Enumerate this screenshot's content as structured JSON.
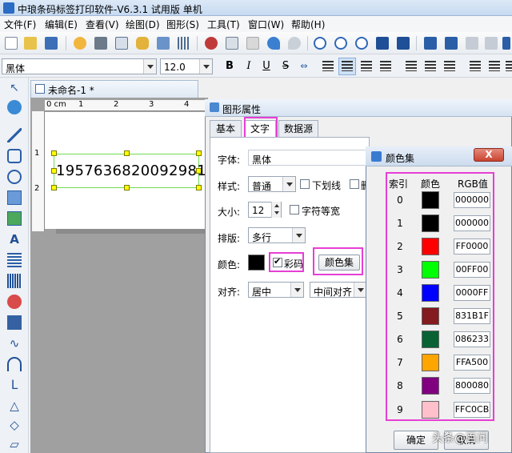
{
  "app": {
    "title": "中琅条码标签打印软件-V6.3.1 试用版 单机"
  },
  "menu": [
    "文件(F)",
    "编辑(E)",
    "查看(V)",
    "绘图(D)",
    "图形(S)",
    "工具(T)",
    "窗口(W)",
    "帮助(H)"
  ],
  "fontbar": {
    "font": "黑体",
    "size": "12.0",
    "bold": "B",
    "italic": "I",
    "underline": "U",
    "strike": "S"
  },
  "document": {
    "tab_title": "未命名-1 *",
    "ruler_unit": "0 cm",
    "ruler_ticks": [
      "1",
      "2",
      "3",
      "4"
    ],
    "ruler_left_ticks": [
      "1",
      "2"
    ],
    "barcode_text": "1957636820092981"
  },
  "prop_dialog": {
    "title": "图形属性",
    "tabs": [
      "基本",
      "文字",
      "数据源"
    ],
    "font_label": "字体:",
    "font_value": "黑体",
    "style_label": "样式:",
    "style_value": "普通",
    "underline_label": "下划线",
    "strike_label": "删",
    "size_label": "大小:",
    "size_value": "12",
    "monospace_label": "字符等宽",
    "layout_label": "排版:",
    "layout_value": "多行",
    "color_label": "颜色:",
    "colorful_label": "彩码",
    "colorset_button": "颜色集",
    "align_label": "对齐:",
    "align_value": "居中",
    "valign_value": "中间对齐"
  },
  "color_set": {
    "title": "颜色集",
    "close": "X",
    "headers": {
      "index": "索引",
      "color": "颜色",
      "rgb": "RGB值"
    },
    "rows": [
      {
        "index": "0",
        "rgb": "000000",
        "color": "#000000"
      },
      {
        "index": "1",
        "rgb": "000000",
        "color": "#000000"
      },
      {
        "index": "2",
        "rgb": "FF0000",
        "color": "#FF0000"
      },
      {
        "index": "3",
        "rgb": "00FF00",
        "color": "#00FF00"
      },
      {
        "index": "4",
        "rgb": "0000FF",
        "color": "#0000FF"
      },
      {
        "index": "5",
        "rgb": "831B1F",
        "color": "#831B1F"
      },
      {
        "index": "6",
        "rgb": "086233",
        "color": "#086233"
      },
      {
        "index": "7",
        "rgb": "FFA500",
        "color": "#FFA500"
      },
      {
        "index": "8",
        "rgb": "800080",
        "color": "#800080"
      },
      {
        "index": "9",
        "rgb": "FFC0CB",
        "color": "#FFC0CB"
      }
    ],
    "ok": "确定",
    "cancel": "取消"
  },
  "watermark": "头条@百问"
}
